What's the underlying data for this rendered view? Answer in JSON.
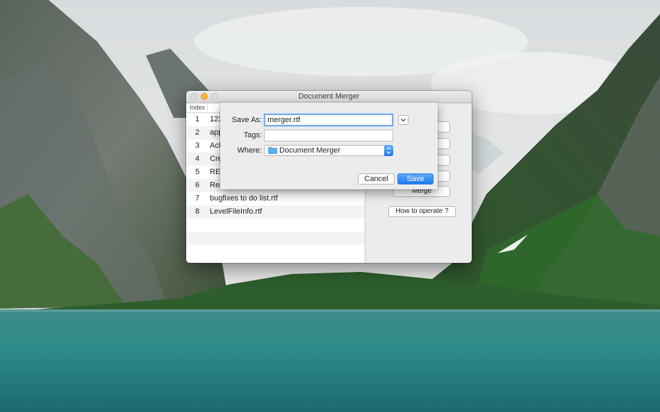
{
  "window": {
    "title": "Document Merger"
  },
  "table": {
    "index_header": "Index",
    "rows": [
      {
        "index": "1",
        "name": "123"
      },
      {
        "index": "2",
        "name": "app"
      },
      {
        "index": "3",
        "name": "Ack"
      },
      {
        "index": "4",
        "name": "Cre"
      },
      {
        "index": "5",
        "name": "REA"
      },
      {
        "index": "6",
        "name": "Rea"
      },
      {
        "index": "7",
        "name": "bugfixes to do list.rtf"
      },
      {
        "index": "8",
        "name": "LevelFileInfo.rtf"
      }
    ]
  },
  "side_buttons": {
    "merge_label": "Merge",
    "howto_label": "How to operate ?"
  },
  "save_sheet": {
    "save_as_label": "Save As:",
    "file_name": "merger.rtf",
    "tags_label": "Tags:",
    "tags_value": "",
    "where_label": "Where:",
    "where_value": "Document Merger",
    "cancel_label": "Cancel",
    "save_label": "Save"
  },
  "colors": {
    "accent": "#1b7cf2",
    "minimize_button": "#f6b73b",
    "focus_ring": "#7aabeb",
    "folder": "#5fb0ee"
  },
  "icons": {
    "folder": "folder-icon",
    "disclosure": "chevron-down-icon",
    "stepper": "up-down-arrows-icon"
  }
}
